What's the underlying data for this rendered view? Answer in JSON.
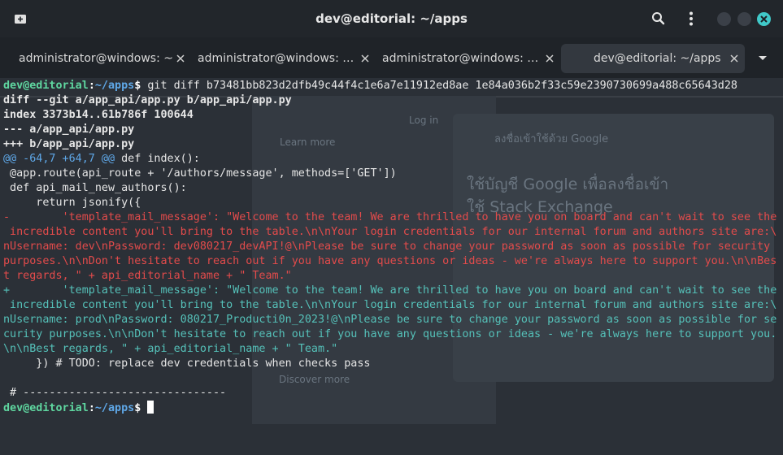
{
  "window": {
    "title": "dev@editorial: ~/apps",
    "icons": {
      "new_tab": "new-tab-icon",
      "search": "search-icon",
      "menu": "kebab-menu-icon",
      "minimize": "minimize-icon",
      "maximize": "maximize-icon",
      "close": "close-icon"
    },
    "accent": "#40c9c9"
  },
  "tabs": [
    {
      "label": "administrator@windows: ~",
      "active": false
    },
    {
      "label": "administrator@windows: …",
      "active": false
    },
    {
      "label": "administrator@windows: …",
      "active": false
    },
    {
      "label": "dev@editorial: ~/apps",
      "active": true
    }
  ],
  "background_ghost": {
    "learn_more": "Learn more",
    "discover_more": "Discover more",
    "log_in": "Log in",
    "google_prompt": "ลงชื่อเข้าใช้ด้วย Google",
    "google_big1": "ใช้บัญชี Google เพื่อลงชื่อเข้า",
    "google_big2": "ใช้ Stack Exchange"
  },
  "terminal": {
    "prompt": {
      "user_host": "dev@editorial",
      "sep": ":",
      "path": "~/apps",
      "symbol": "$"
    },
    "command": " git diff b73481bb823d2dfb49c44f4c1e6a7e11912ed8ae 1e84a036b2f33c59e2390730699a488c65643d28",
    "diff_header": [
      "diff --git a/app_api/app.py b/app_api/app.py",
      "index 3373b14..61b786f 100644",
      "--- a/app_api/app.py",
      "+++ b/app_api/app.py"
    ],
    "hunk_marker": "@@ -64,7 +64,7 @@",
    "hunk_context": " def index():",
    "context_lines": [
      " @app.route(api_route + '/authors/message', methods=['GET'])",
      " def api_mail_new_authors():",
      "     return jsonify({"
    ],
    "removed_lines": [
      "-        'template_mail_message': \"Welcome to the team! We are thrilled to have you on board and can't wait to see the",
      " incredible content you'll bring to the table.\\n\\nYour login credentials for our internal forum and authors site are:\\",
      "nUsername: dev\\nPassword: dev080217_devAPI!@\\nPlease be sure to change your password as soon as possible for security",
      "purposes.\\n\\nDon't hesitate to reach out if you have any questions or ideas - we're always here to support you.\\n\\nBes",
      "t regards, \" + api_editorial_name + \" Team.\""
    ],
    "added_lines": [
      "+        'template_mail_message': \"Welcome to the team! We are thrilled to have you on board and can't wait to see the",
      " incredible content you'll bring to the table.\\n\\nYour login credentials for our internal forum and authors site are:\\",
      "nUsername: prod\\nPassword: 080217_Producti0n_2023!@\\nPlease be sure to change your password as soon as possible for se",
      "curity purposes.\\n\\nDon't hesitate to reach out if you have any questions or ideas - we're always here to support you.",
      "\\n\\nBest regards, \" + api_editorial_name + \" Team.\""
    ],
    "trailing_lines": [
      "     }) # TODO: replace dev credentials when checks pass",
      "",
      " # -------------------------------"
    ],
    "colors": {
      "prompt_user": "#5fd7a0",
      "prompt_path": "#5fa8e8",
      "removed": "#e34b4b",
      "added": "#55c1b9"
    }
  }
}
